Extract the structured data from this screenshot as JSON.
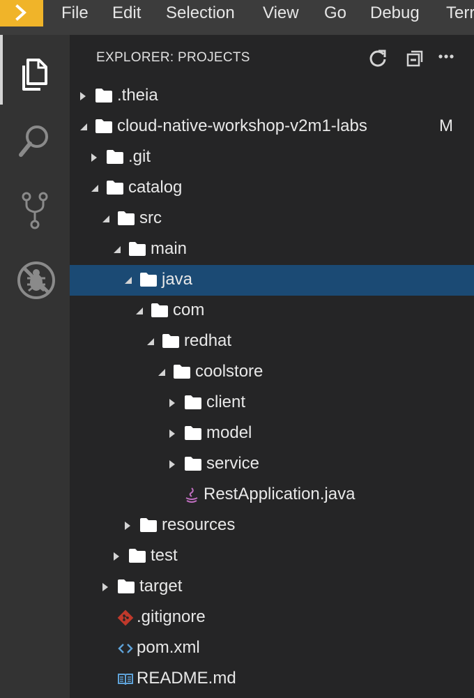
{
  "menu": {
    "items": [
      "File",
      "Edit",
      "Selection",
      "View",
      "Go",
      "Debug",
      "Terr"
    ]
  },
  "activity_bar": {
    "icons": [
      "files-icon",
      "search-icon",
      "source-control-icon",
      "debug-disabled-icon"
    ]
  },
  "explorer": {
    "title": "EXPLORER: PROJECTS",
    "actions": [
      "refresh-icon",
      "collapse-all-icon",
      "more-icon"
    ]
  },
  "tree": [
    {
      "label": ".theia",
      "kind": "folder",
      "expanded": false,
      "depth": 0
    },
    {
      "label": "cloud-native-workshop-v2m1-labs",
      "kind": "folder",
      "expanded": true,
      "depth": 0,
      "badge": "M"
    },
    {
      "label": ".git",
      "kind": "folder",
      "expanded": false,
      "depth": 1
    },
    {
      "label": "catalog",
      "kind": "folder",
      "expanded": true,
      "depth": 1
    },
    {
      "label": "src",
      "kind": "folder",
      "expanded": true,
      "depth": 2
    },
    {
      "label": "main",
      "kind": "folder",
      "expanded": true,
      "depth": 3
    },
    {
      "label": "java",
      "kind": "folder",
      "expanded": true,
      "depth": 4,
      "selected": true
    },
    {
      "label": "com",
      "kind": "folder",
      "expanded": true,
      "depth": 5
    },
    {
      "label": "redhat",
      "kind": "folder",
      "expanded": true,
      "depth": 6
    },
    {
      "label": "coolstore",
      "kind": "folder",
      "expanded": true,
      "depth": 7
    },
    {
      "label": "client",
      "kind": "folder",
      "expanded": false,
      "depth": 8
    },
    {
      "label": "model",
      "kind": "folder",
      "expanded": false,
      "depth": 8
    },
    {
      "label": "service",
      "kind": "folder",
      "expanded": false,
      "depth": 8
    },
    {
      "label": "RestApplication.java",
      "kind": "file",
      "icon": "java-icon",
      "depth": 8
    },
    {
      "label": "resources",
      "kind": "folder",
      "expanded": false,
      "depth": 4
    },
    {
      "label": "test",
      "kind": "folder",
      "expanded": false,
      "depth": 3
    },
    {
      "label": "target",
      "kind": "folder",
      "expanded": false,
      "depth": 2
    },
    {
      "label": ".gitignore",
      "kind": "file",
      "icon": "git-icon",
      "depth": 2
    },
    {
      "label": "pom.xml",
      "kind": "file",
      "icon": "xml-code-icon",
      "depth": 2
    },
    {
      "label": "README.md",
      "kind": "file",
      "icon": "markdown-book-icon",
      "depth": 2
    }
  ],
  "colors": {
    "accent": "#f0b429",
    "selection": "#1b4a74",
    "git_icon": "#c0392b",
    "java_icon": "#c06fc0",
    "xml_icon": "#5fa3d9",
    "md_icon": "#5fa3d9"
  }
}
